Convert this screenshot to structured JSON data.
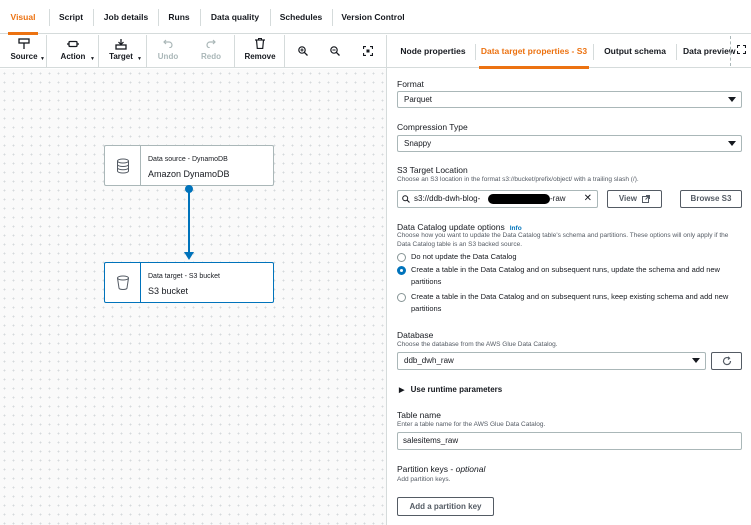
{
  "top_tabs": [
    {
      "label": "Visual",
      "active": true
    },
    {
      "label": "Script"
    },
    {
      "label": "Job details"
    },
    {
      "label": "Runs"
    },
    {
      "label": "Data quality"
    },
    {
      "label": "Schedules"
    },
    {
      "label": "Version Control"
    }
  ],
  "toolbar": {
    "source": "Source",
    "action": "Action",
    "target": "Target",
    "undo": "Undo",
    "redo": "Redo",
    "remove": "Remove"
  },
  "canvas": {
    "nodes": [
      {
        "type": "Data source - DynamoDB",
        "name": "Amazon DynamoDB",
        "icon": "dynamodb-icon"
      },
      {
        "type": "Data target - S3 bucket",
        "name": "S3 bucket",
        "icon": "s3-bucket-icon"
      }
    ]
  },
  "panel_tabs": [
    {
      "label": "Node properties"
    },
    {
      "label": "Data target properties - S3",
      "active": true
    },
    {
      "label": "Output schema"
    },
    {
      "label": "Data preview"
    }
  ],
  "form": {
    "format": {
      "label": "Format",
      "value": "Parquet"
    },
    "compression": {
      "label": "Compression Type",
      "value": "Snappy"
    },
    "s3_location": {
      "label": "S3 Target Location",
      "description": "Choose an S3 location in the format s3://bucket/prefix/object/ with a trailing slash (/).",
      "value_prefix": "s3://ddb-dwh-blog-",
      "value_suffix": "-raw",
      "view_label": "View",
      "browse_label": "Browse S3"
    },
    "catalog": {
      "label": "Data Catalog update options",
      "info": "Info",
      "description": "Choose how you want to update the Data Catalog table's schema and partitions. These options will only apply if the Data Catalog table is an S3 backed source.",
      "options": [
        {
          "label": "Do not update the Data Catalog",
          "checked": false
        },
        {
          "label": "Create a table in the Data Catalog and on subsequent runs, update the schema and add new partitions",
          "checked": true
        },
        {
          "label": "Create a table in the Data Catalog and on subsequent runs, keep existing schema and add new partitions",
          "checked": false
        }
      ]
    },
    "database": {
      "label": "Database",
      "description": "Choose the database from the AWS Glue Data Catalog.",
      "value": "ddb_dwh_raw"
    },
    "runtime_params": "Use runtime parameters",
    "table_name": {
      "label": "Table name",
      "description": "Enter a table name for the AWS Glue Data Catalog.",
      "value": "salesitems_raw"
    },
    "partition_keys": {
      "label": "Partition keys",
      "optional": "optional",
      "description": "Add partition keys.",
      "button": "Add a partition key"
    }
  },
  "colors": {
    "accent": "#ec7211",
    "link": "#0073bb",
    "border": "#aab7b8"
  }
}
